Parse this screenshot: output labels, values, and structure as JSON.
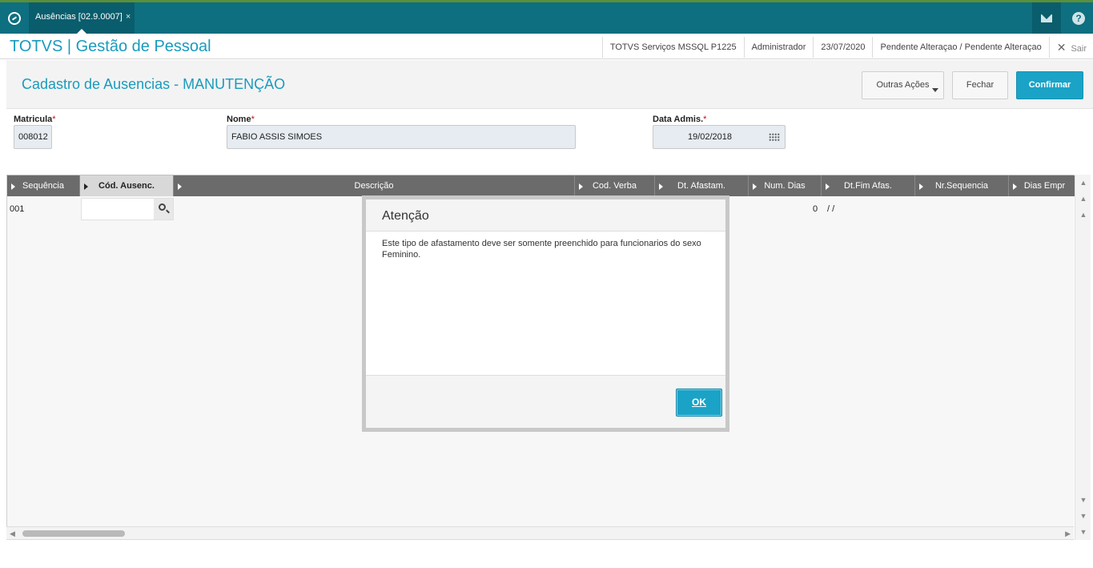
{
  "topbar": {
    "tab_label": "Ausências [02.9.0007]",
    "tab_close": "×"
  },
  "header": {
    "brand": "TOTVS | Gestão de Pessoal",
    "environment": "TOTVS Serviços MSSQL P1225",
    "user": "Administrador",
    "date": "23/07/2020",
    "status": "Pendente Alteraçao / Pendente Alteraçao",
    "exit_label": "Sair"
  },
  "page": {
    "title": "Cadastro de Ausencias - MANUTENÇÃO",
    "buttons": {
      "other_actions": "Outras Ações",
      "close": "Fechar",
      "confirm": "Confirmar"
    }
  },
  "form": {
    "matricula": {
      "label": "Matricula",
      "value": "008012"
    },
    "nome": {
      "label": "Nome",
      "value": "FABIO ASSIS SIMOES"
    },
    "data_admis": {
      "label": "Data Admis.",
      "value": "19/02/2018"
    },
    "required_mark": "*"
  },
  "grid": {
    "columns": [
      "Sequência",
      "Cód. Ausenc.",
      "Descrição",
      "Cod. Verba",
      "Dt. Afastam.",
      "Num. Dias",
      "Dt.Fim Afas.",
      "Nr.Sequencia",
      "Dias Empr"
    ],
    "row": {
      "sequencia": "001",
      "cod_ausenc": "",
      "num_dias": "0",
      "dt_fim": "/ /"
    }
  },
  "modal": {
    "title": "Atenção",
    "message": "Este tipo de afastamento deve ser somente preenchido para funcionarios do sexo Feminino.",
    "ok_label": "OK"
  },
  "icons": {
    "home": "totvs-menu-icon",
    "mail": "mail-icon",
    "help": "help-icon",
    "calendar": "calendar-icon",
    "lookup": "search-icon",
    "close": "close-icon"
  },
  "colors": {
    "topbar": "#0d6f80",
    "accent": "#1a9bbd",
    "primary_button": "#1aa3c7",
    "grid_header": "#6b6b6b",
    "required": "#d0021b"
  }
}
